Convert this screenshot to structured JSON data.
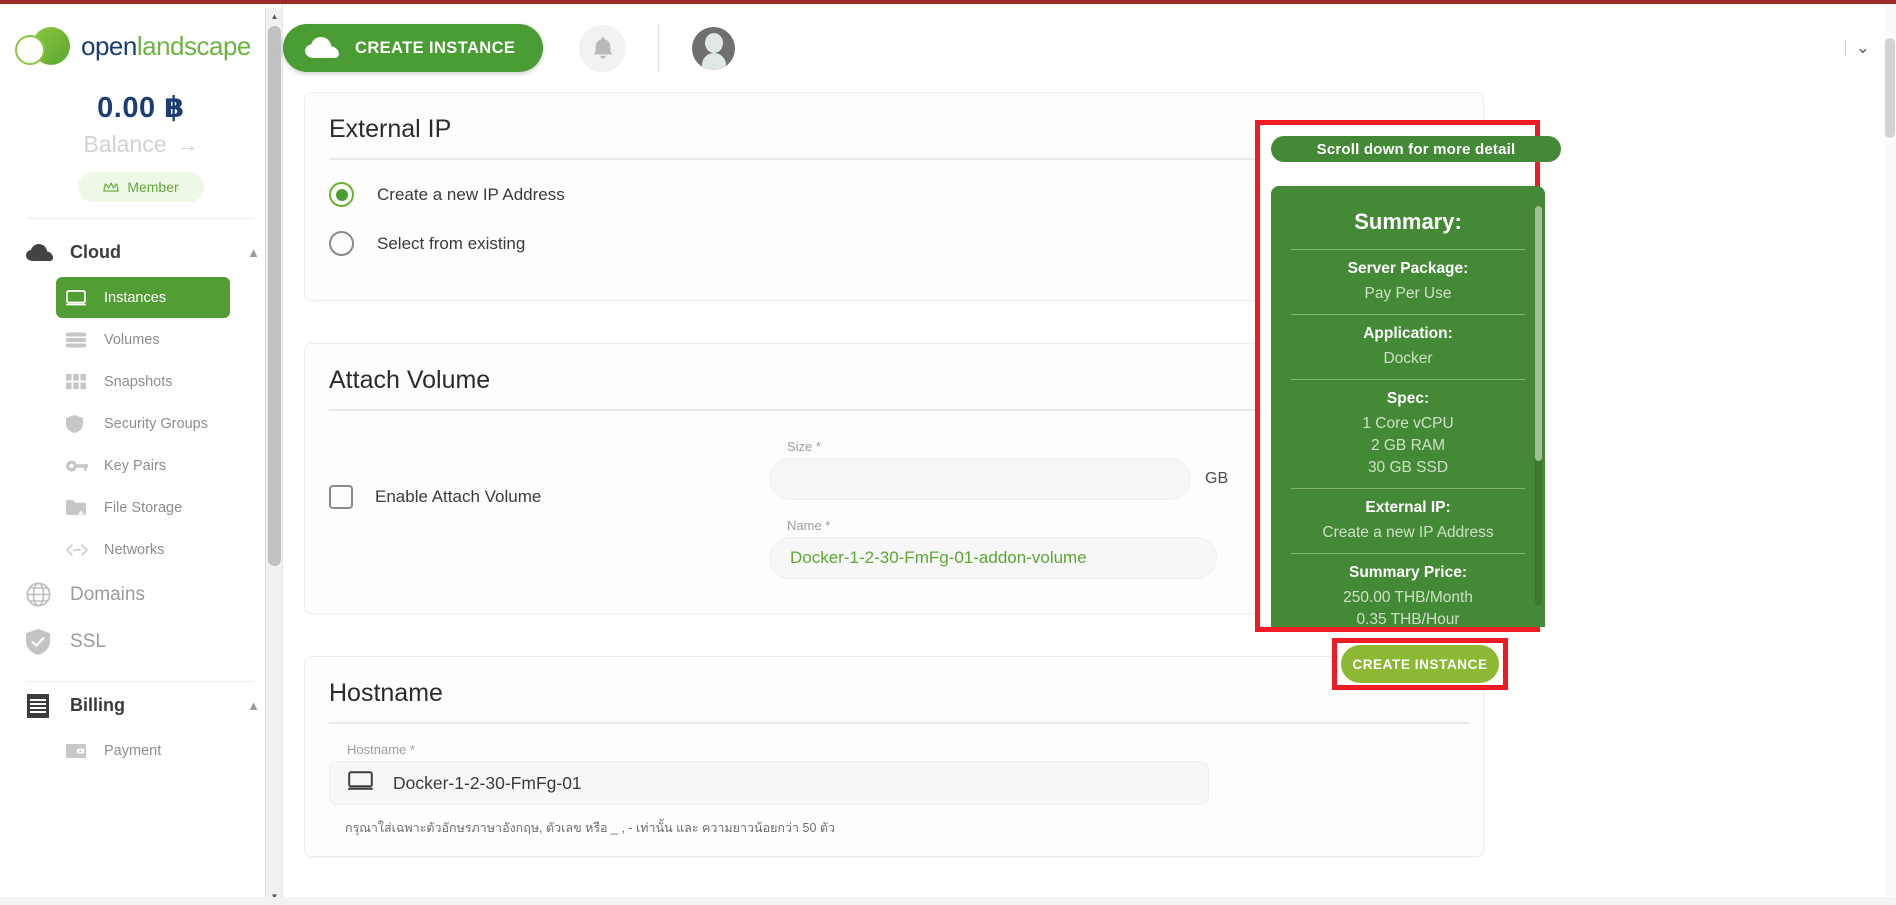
{
  "brand": {
    "name_open": "open",
    "name_landscape": "landscape"
  },
  "sidebar": {
    "balance_amount": "0.00 ฿",
    "balance_label": "Balance",
    "balance_arrow": "→",
    "member_badge": "Member",
    "groups": [
      {
        "label": "Cloud",
        "icon": "cloud-icon",
        "expanded": true
      },
      {
        "label": "Domains",
        "icon": "globe-icon"
      },
      {
        "label": "SSL",
        "icon": "shield-check-icon"
      },
      {
        "label": "Billing",
        "icon": "receipt-icon",
        "expanded": true
      }
    ],
    "cloud_items": [
      {
        "label": "Instances",
        "icon": "monitor-icon",
        "active": true
      },
      {
        "label": "Volumes",
        "icon": "server-list-icon",
        "active": false
      },
      {
        "label": "Snapshots",
        "icon": "grid-icon",
        "active": false
      },
      {
        "label": "Security Groups",
        "icon": "shield-icon",
        "active": false
      },
      {
        "label": "Key Pairs",
        "icon": "key-icon",
        "active": false
      },
      {
        "label": "File Storage",
        "icon": "folder-icon",
        "active": false
      },
      {
        "label": "Networks",
        "icon": "network-icon",
        "active": false
      }
    ],
    "billing_items": [
      {
        "label": "Payment",
        "icon": "wallet-icon",
        "active": false
      }
    ]
  },
  "topbar": {
    "create_instance_label": "CREATE INSTANCE",
    "bell_icon": "bell-icon",
    "avatar_icon": "avatar-icon",
    "account_chevron": "⌄"
  },
  "main": {
    "external_ip": {
      "title": "External IP",
      "options": [
        {
          "label": "Create a new IP Address",
          "selected": true
        },
        {
          "label": "Select from existing",
          "selected": false
        }
      ]
    },
    "attach_volume": {
      "title": "Attach Volume",
      "checkbox_label": "Enable Attach Volume",
      "checked": false,
      "size_label": "Size *",
      "size_value": "",
      "size_unit": "GB",
      "name_label": "Name *",
      "name_value": "Docker-1-2-30-FmFg-01-addon-volume"
    },
    "hostname": {
      "title": "Hostname",
      "field_label": "Hostname *",
      "value": "Docker-1-2-30-FmFg-01",
      "icon": "monitor-icon",
      "hint": "กรุณาใส่เฉพาะตัวอักษรภาษาอังกฤษ, ตัวเลข หรือ _ , - เท่านั้น และ ความยาวน้อยกว่า 50 ตัว"
    }
  },
  "summary": {
    "scroll_note": "Scroll down for more detail",
    "title": "Summary:",
    "rows": [
      {
        "key": "Server Package:",
        "values": [
          "Pay Per Use"
        ]
      },
      {
        "key": "Application:",
        "values": [
          "Docker"
        ]
      },
      {
        "key": "Spec:",
        "values": [
          "1 Core vCPU",
          "2 GB RAM",
          "30 GB SSD"
        ]
      },
      {
        "key": "External IP:",
        "values": [
          "Create a new IP Address"
        ]
      },
      {
        "key": "Summary Price:",
        "values": [
          "250.00 THB/Month",
          "0.35 THB/Hour"
        ]
      }
    ],
    "cta_label": "CREATE INSTANCE",
    "highlight_color": "#ef1c23",
    "panel_color": "#448a36",
    "cta_color": "#8cb833"
  }
}
